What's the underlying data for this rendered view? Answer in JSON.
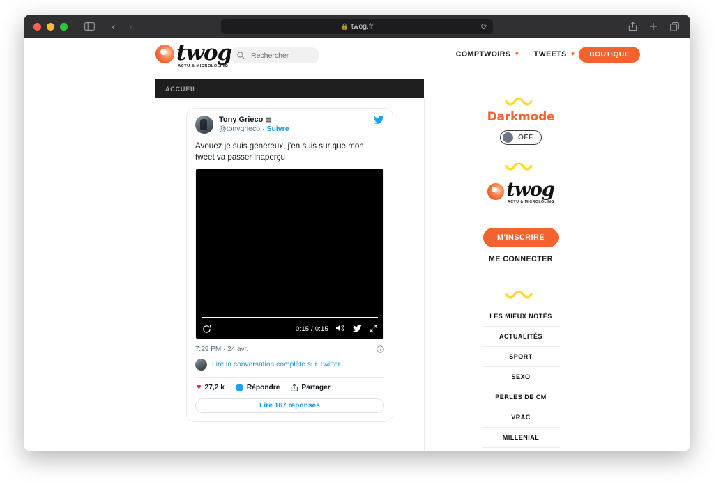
{
  "browser": {
    "url": "twog.fr",
    "lock_icon": "lock-icon",
    "reload_icon": "reload-icon",
    "sidebar_icon": "sidebar-toggle-icon",
    "back_icon": "chevron-left-icon",
    "forward_icon": "chevron-right-icon",
    "share_icon": "share-icon",
    "newtab_icon": "plus-icon",
    "tabs_icon": "tab-overview-icon"
  },
  "header": {
    "logo_word": "twog",
    "logo_tagline": "ACTU & MICROLOLING",
    "search_placeholder": "Rechercher",
    "nav": [
      {
        "label": "COMPTWOIRS",
        "has_caret": true
      },
      {
        "label": "TWEETS",
        "has_caret": true
      }
    ],
    "boutique_label": "BOUTIQUE",
    "accueil_label": "ACCUEIL"
  },
  "tweet": {
    "author_name": "Tony Grieco",
    "author_badge": "▤",
    "handle": "@tonygrieco",
    "separator": "·",
    "follow_label": "Suivre",
    "text": "Avouez je suis généreux, j'en suis sur que mon tweet va passer inaperçu",
    "video": {
      "current_time": "0:15",
      "duration": "0:15",
      "time_display": "0:15 / 0:15",
      "progress_percent": 100,
      "replay_icon": "replay-icon",
      "mute_icon": "volume-icon",
      "twitter_icon": "twitter-bird-icon",
      "fullscreen_icon": "expand-icon"
    },
    "timestamp": "7:29 PM · 24 avr.",
    "info_icon": "info-icon",
    "conversation_link": "Lire la conversation complète sur Twitter",
    "likes": "27,2 k",
    "reply_label": "Répondre",
    "share_label": "Partager",
    "replies_button": "Lire 167 réponses"
  },
  "sidebar": {
    "darkmode_title": "Darkmode",
    "toggle_state": "OFF",
    "logo_word": "twog",
    "logo_tagline": "ACTU & MICROLOLING",
    "signup_label": "M'INSCRIRE",
    "login_label": "ME CONNECTER",
    "menu": [
      {
        "label": "LES MIEUX NOTÉS"
      },
      {
        "label": "ACTUALITÉS"
      },
      {
        "label": "SPORT"
      },
      {
        "label": "SEXO"
      },
      {
        "label": "PERLES DE CM"
      },
      {
        "label": "VRAC"
      },
      {
        "label": "MILLENIAL"
      }
    ]
  },
  "colors": {
    "brand_orange": "#f4622e",
    "twitter_blue": "#1da1f2",
    "link_blue": "#1b95e0",
    "like_pink": "#e0245e",
    "squiggle_yellow": "#ffd92e",
    "dark_bar": "#1e1e1e"
  }
}
